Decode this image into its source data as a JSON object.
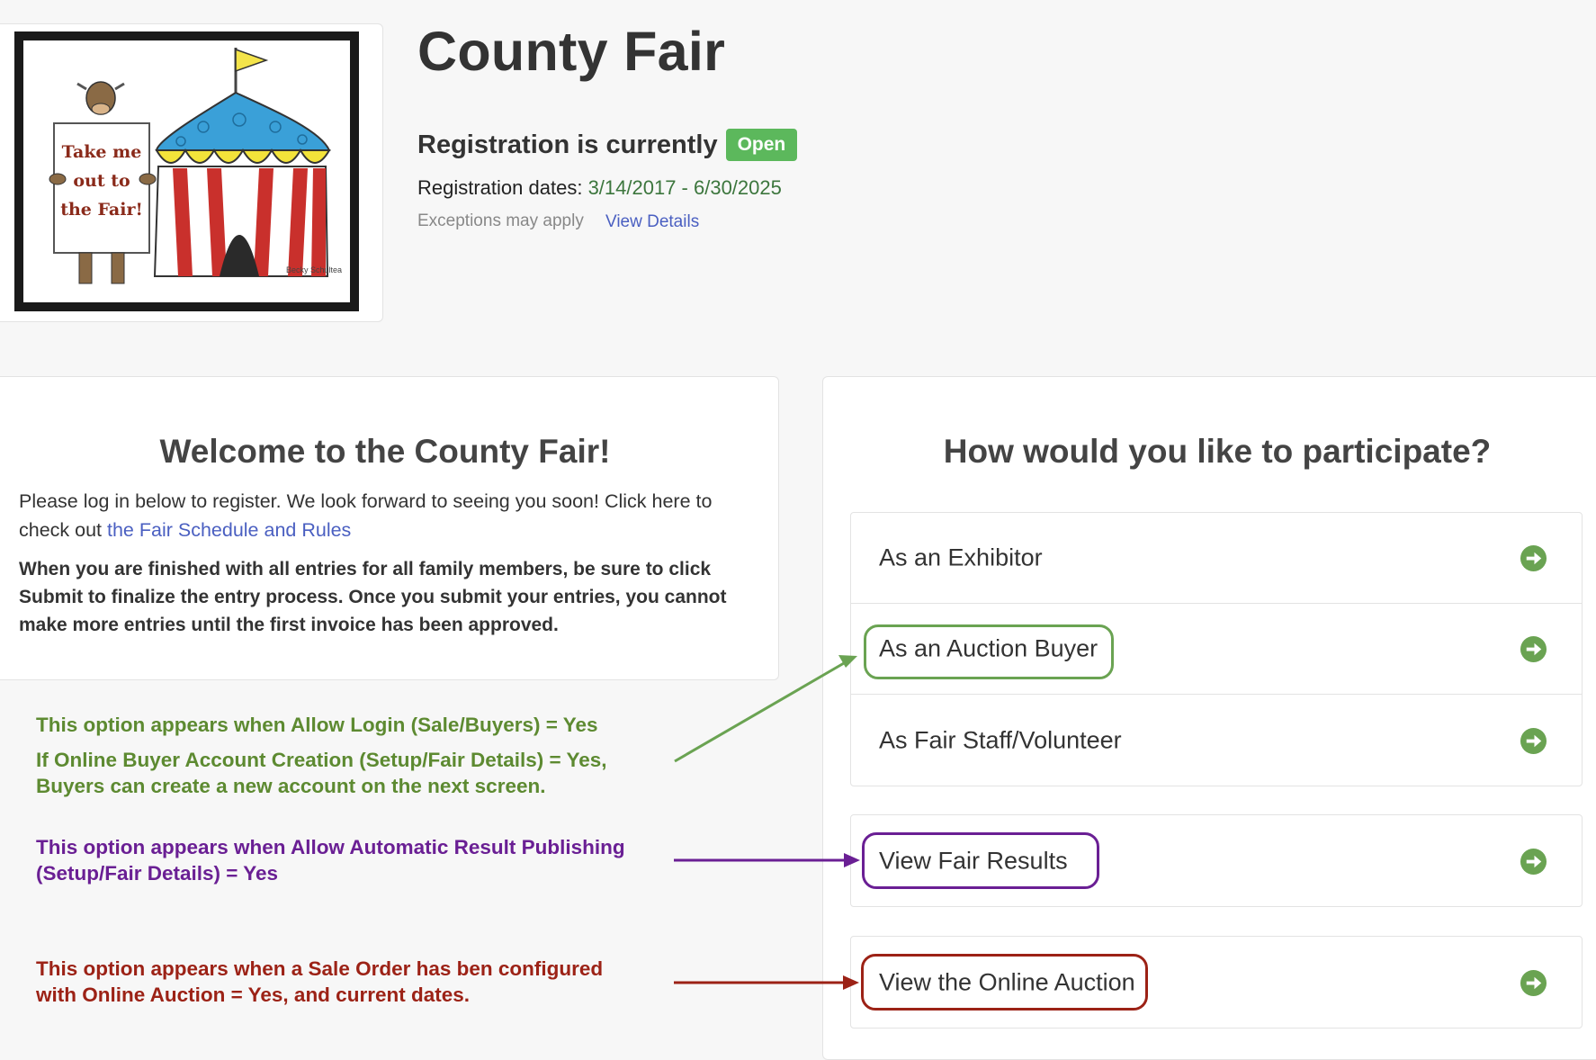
{
  "header": {
    "title": "County Fair",
    "registration_prefix": "Registration is currently",
    "registration_status": "Open",
    "dates_label": "Registration dates:",
    "dates_value": "3/14/2017 - 6/30/2025",
    "exceptions_text": "Exceptions may apply",
    "view_details_link": "View Details"
  },
  "logo": {
    "sign_line1": "Take me",
    "sign_line2": "out to",
    "sign_line3": "the Fair!",
    "artist_credit": "Becky Schultea"
  },
  "welcome": {
    "title": "Welcome to the County Fair!",
    "intro_text": "Please log in below to register. We look forward to seeing you soon! Click here to check out ",
    "schedule_link": "the Fair Schedule and Rules",
    "bold_text": "When you are finished with all entries for all family members, be sure to click Submit to finalize the entry process. Once you submit your entries, you cannot make more entries until the first invoice has been approved."
  },
  "participate": {
    "title": "How would you like to participate?",
    "options": [
      {
        "label": "As an Exhibitor",
        "icon": "arrow-circle-right-icon"
      },
      {
        "label": "As an Auction Buyer",
        "icon": "arrow-circle-right-icon"
      },
      {
        "label": "As Fair Staff/Volunteer",
        "icon": "arrow-circle-right-icon"
      }
    ],
    "results_option": {
      "label": "View Fair Results",
      "icon": "arrow-circle-right-icon"
    },
    "auction_option": {
      "label": "View the Online Auction",
      "icon": "arrow-circle-right-icon"
    }
  },
  "annotations": {
    "buyer_note_line1": "This option appears when Allow Login (Sale/Buyers) = Yes",
    "buyer_note_line2": "If Online Buyer Account Creation (Setup/Fair Details) = Yes,",
    "buyer_note_line3": "Buyers can create a new account on the next screen.",
    "results_note_line1": "This option appears when Allow Automatic Result Publishing",
    "results_note_line2": "(Setup/Fair Details) = Yes",
    "auction_note_line1": "This option appears when a Sale Order has ben configured",
    "auction_note_line2": "with Online Auction = Yes, and current dates."
  },
  "colors": {
    "open_badge": "#5cb85c",
    "link": "#4a5fc1",
    "dates": "#3c763d",
    "arrow_icon": "#6aa352",
    "annotation_green": "#5d8a31",
    "annotation_purple": "#6a1f94",
    "annotation_red": "#9c2216"
  }
}
